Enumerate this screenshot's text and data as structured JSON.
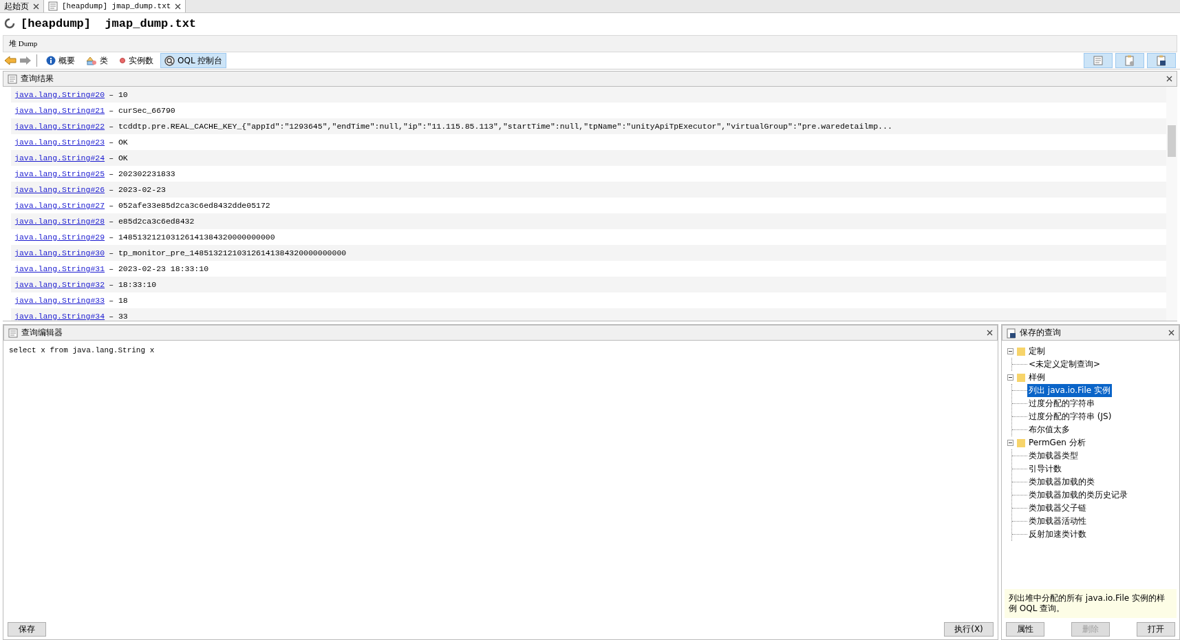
{
  "tabs": [
    {
      "label": "起始页",
      "selected": false
    },
    {
      "label": "[heapdump] jmap_dump.txt",
      "selected": true
    }
  ],
  "title": "[heapdump]  jmap_dump.txt",
  "breadcrumb": "堆 Dump",
  "toolbar": [
    {
      "label": "概要",
      "kind": "info",
      "selected": false
    },
    {
      "label": "类",
      "kind": "classes",
      "selected": false
    },
    {
      "label": "实例数",
      "kind": "instances",
      "selected": false
    },
    {
      "label": "OQL 控制台",
      "kind": "oql",
      "selected": true
    }
  ],
  "results": {
    "title": "查询结果",
    "rows": [
      {
        "link": "java.lang.String#20",
        "value": "– 10"
      },
      {
        "link": "java.lang.String#21",
        "value": "– curSec_66790"
      },
      {
        "link": "java.lang.String#22",
        "value": "– tcddtp.pre.REAL_CACHE_KEY_{\"appId\":\"1293645\",\"endTime\":null,\"ip\":\"11.115.85.113\",\"startTime\":null,\"tpName\":\"unityApiTpExecutor\",\"virtualGroup\":\"pre.waredetailmp..."
      },
      {
        "link": "java.lang.String#23",
        "value": "– OK"
      },
      {
        "link": "java.lang.String#24",
        "value": "– OK"
      },
      {
        "link": "java.lang.String#25",
        "value": "– 202302231833"
      },
      {
        "link": "java.lang.String#26",
        "value": "– 2023-02-23"
      },
      {
        "link": "java.lang.String#27",
        "value": "– 052afe33e85d2ca3c6ed8432dde05172"
      },
      {
        "link": "java.lang.String#28",
        "value": "– e85d2ca3c6ed8432"
      },
      {
        "link": "java.lang.String#29",
        "value": "– 148513212103126141384320000000000"
      },
      {
        "link": "java.lang.String#30",
        "value": "– tp_monitor_pre_148513212103126141384320000000000"
      },
      {
        "link": "java.lang.String#31",
        "value": "– 2023-02-23 18:33:10"
      },
      {
        "link": "java.lang.String#32",
        "value": "– 18:33:10"
      },
      {
        "link": "java.lang.String#33",
        "value": "– 18"
      },
      {
        "link": "java.lang.String#34",
        "value": "– 33"
      }
    ]
  },
  "editor": {
    "title": "查询编辑器",
    "query": "select x from java.lang.String x",
    "save_button": "保存",
    "execute_button": "执行(X)"
  },
  "saved_queries": {
    "title": "保存的查询",
    "tree": [
      {
        "label": "定制",
        "expanded": true,
        "children": [
          {
            "label": "<未定义定制查询>",
            "selected": false
          }
        ]
      },
      {
        "label": "样例",
        "expanded": true,
        "children": [
          {
            "label": "列出 java.io.File 实例",
            "selected": true
          },
          {
            "label": "过度分配的字符串",
            "selected": false
          },
          {
            "label": "过度分配的字符串 (JS)",
            "selected": false
          },
          {
            "label": "布尔值太多",
            "selected": false
          }
        ]
      },
      {
        "label": "PermGen 分析",
        "expanded": true,
        "children": [
          {
            "label": "类加载器类型",
            "selected": false
          },
          {
            "label": "引导计数",
            "selected": false
          },
          {
            "label": "类加载器加载的类",
            "selected": false
          },
          {
            "label": "类加载器加载的类历史记录",
            "selected": false
          },
          {
            "label": "类加载器父子链",
            "selected": false
          },
          {
            "label": "类加载器活动性",
            "selected": false
          },
          {
            "label": "反射加速类计数",
            "selected": false
          }
        ]
      }
    ],
    "description": "列出堆中分配的所有 java.io.File 实例的样例 OQL 查询。",
    "buttons": [
      {
        "label": "属性",
        "disabled": false
      },
      {
        "label": "删除",
        "disabled": true
      },
      {
        "label": "打开",
        "disabled": false
      }
    ]
  }
}
